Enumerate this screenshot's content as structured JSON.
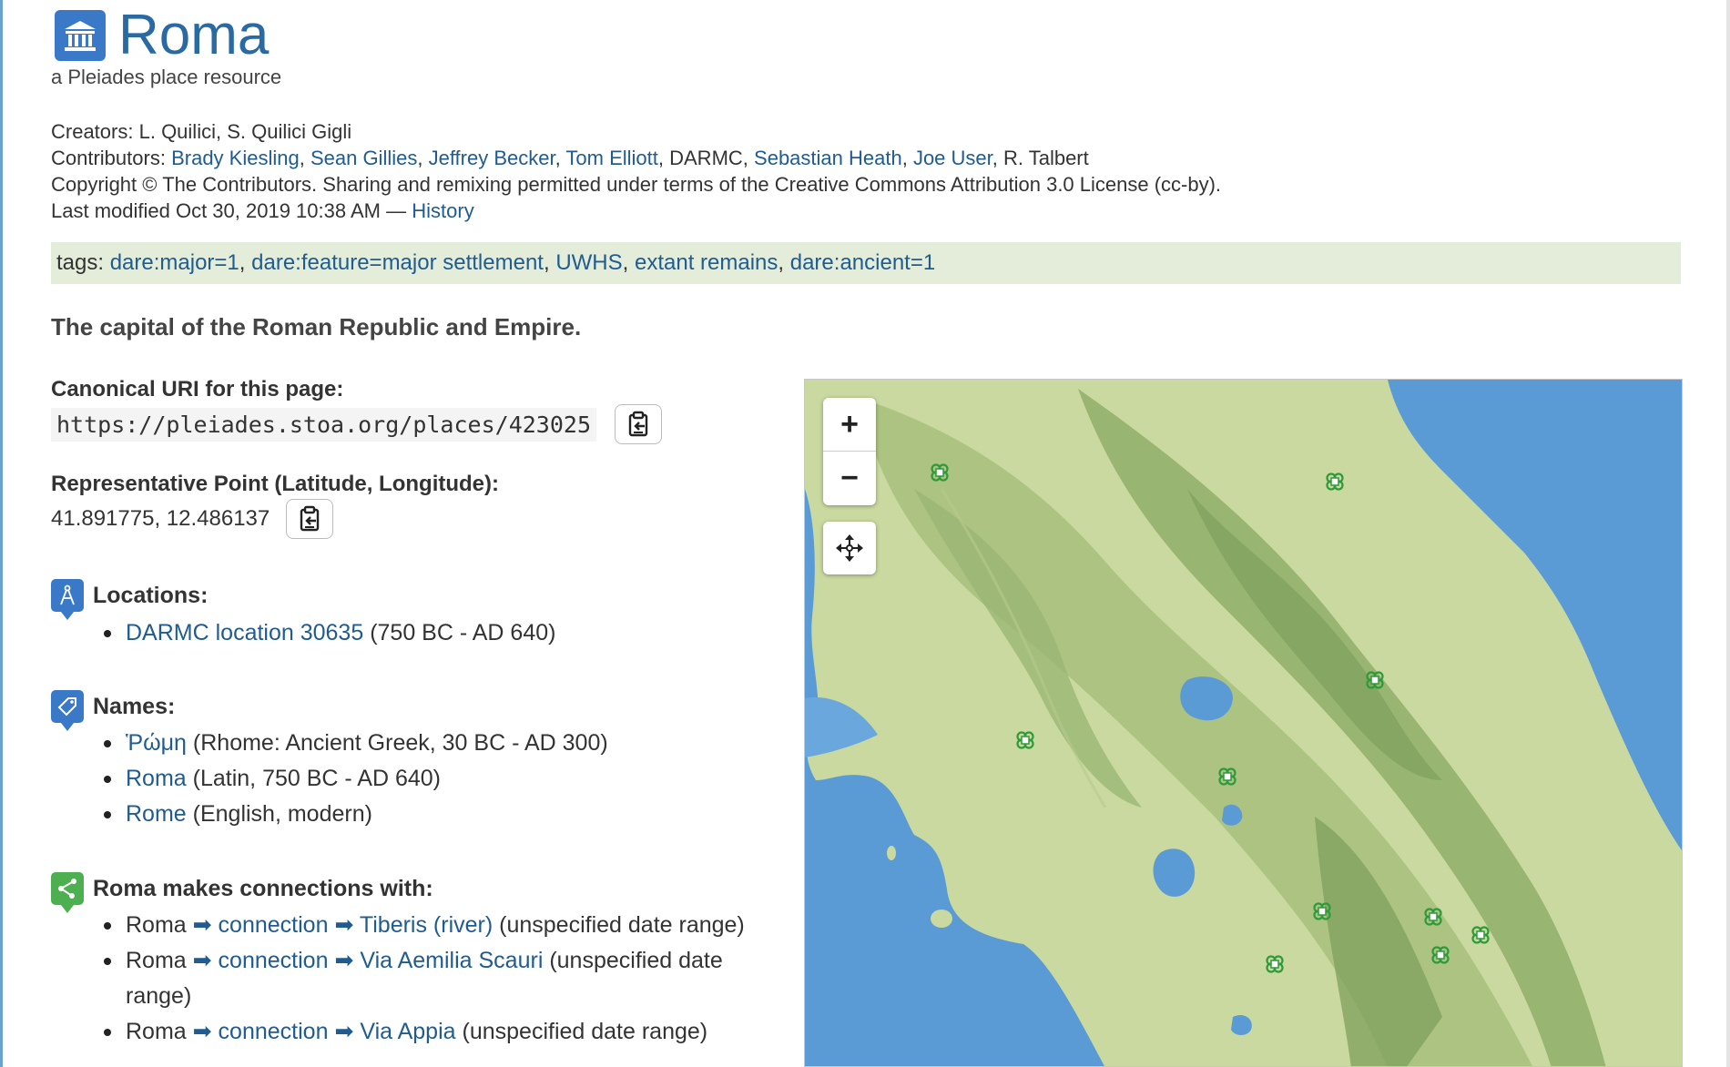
{
  "header": {
    "title": "Roma",
    "subtitle": "a Pleiades place resource",
    "place_icon": "building-columns-icon"
  },
  "meta": {
    "creators_label": "Creators:",
    "creators": "L. Quilici, S. Quilici Gigli",
    "contributors_label": "Contributors:",
    "contributors": [
      {
        "name": "Brady Kiesling",
        "link": true
      },
      {
        "name": "Sean Gillies",
        "link": true
      },
      {
        "name": "Jeffrey Becker",
        "link": true
      },
      {
        "name": "Tom Elliott",
        "link": true
      },
      {
        "name": "DARMC",
        "link": false
      },
      {
        "name": "Sebastian Heath",
        "link": true
      },
      {
        "name": "Joe User",
        "link": true
      },
      {
        "name": "R. Talbert",
        "link": false
      }
    ],
    "copyright": "Copyright © The Contributors. Sharing and remixing permitted under terms of the Creative Commons Attribution 3.0 License (cc-by).",
    "last_modified": "Last modified Oct 30, 2019 10:38 AM —",
    "history_link": "History"
  },
  "tags": {
    "label": "tags:",
    "items": [
      "dare:major=1",
      "dare:feature=major settlement",
      "UWHS",
      "extant remains",
      "dare:ancient=1"
    ]
  },
  "description": "The capital of the Roman Republic and Empire.",
  "canonical_uri": {
    "label": "Canonical URI for this page:",
    "value": "https://pleiades.stoa.org/places/423025"
  },
  "representative_point": {
    "label": "Representative Point (Latitude, Longitude):",
    "value": "41.891775, 12.486137"
  },
  "locations": {
    "title": "Locations:",
    "icon": "compass-icon",
    "items": [
      {
        "link": "DARMC location 30635",
        "detail": "(750 BC - AD 640)"
      }
    ]
  },
  "names": {
    "title": "Names:",
    "icon": "tag-icon",
    "items": [
      {
        "link": "Ῥώμη",
        "detail": "(Rhome: Ancient Greek, 30 BC - AD 300)"
      },
      {
        "link": "Roma",
        "detail": "(Latin, 750 BC - AD 640)"
      },
      {
        "link": "Rome",
        "detail": "(English, modern)"
      }
    ]
  },
  "connections": {
    "title": "Roma makes connections with:",
    "icon": "share-icon",
    "items": [
      {
        "source": "Roma",
        "relation": "connection",
        "target": "Tiberis (river)",
        "detail": "(unspecified date range)"
      },
      {
        "source": "Roma",
        "relation": "connection",
        "target": "Via Aemilia Scauri",
        "detail": "(unspecified date range)"
      },
      {
        "source": "Roma",
        "relation": "connection",
        "target": "Via Appia",
        "detail": "(unspecified date range)"
      }
    ]
  },
  "map": {
    "zoom_in": "+",
    "zoom_out": "−",
    "pan_icon": "move-arrows-icon",
    "marker_icon": "place-marker-icon",
    "colors": {
      "sea": "#5b9bd5",
      "land": "#c5d69c",
      "forest": "#8fae6a",
      "marker": "#2e9a3a"
    }
  },
  "colors": {
    "link": "#205c90",
    "title": "#2a6aa3",
    "tags_bg": "#e3edd9",
    "icon_blue": "#3a78c8",
    "icon_green": "#4caf50"
  }
}
